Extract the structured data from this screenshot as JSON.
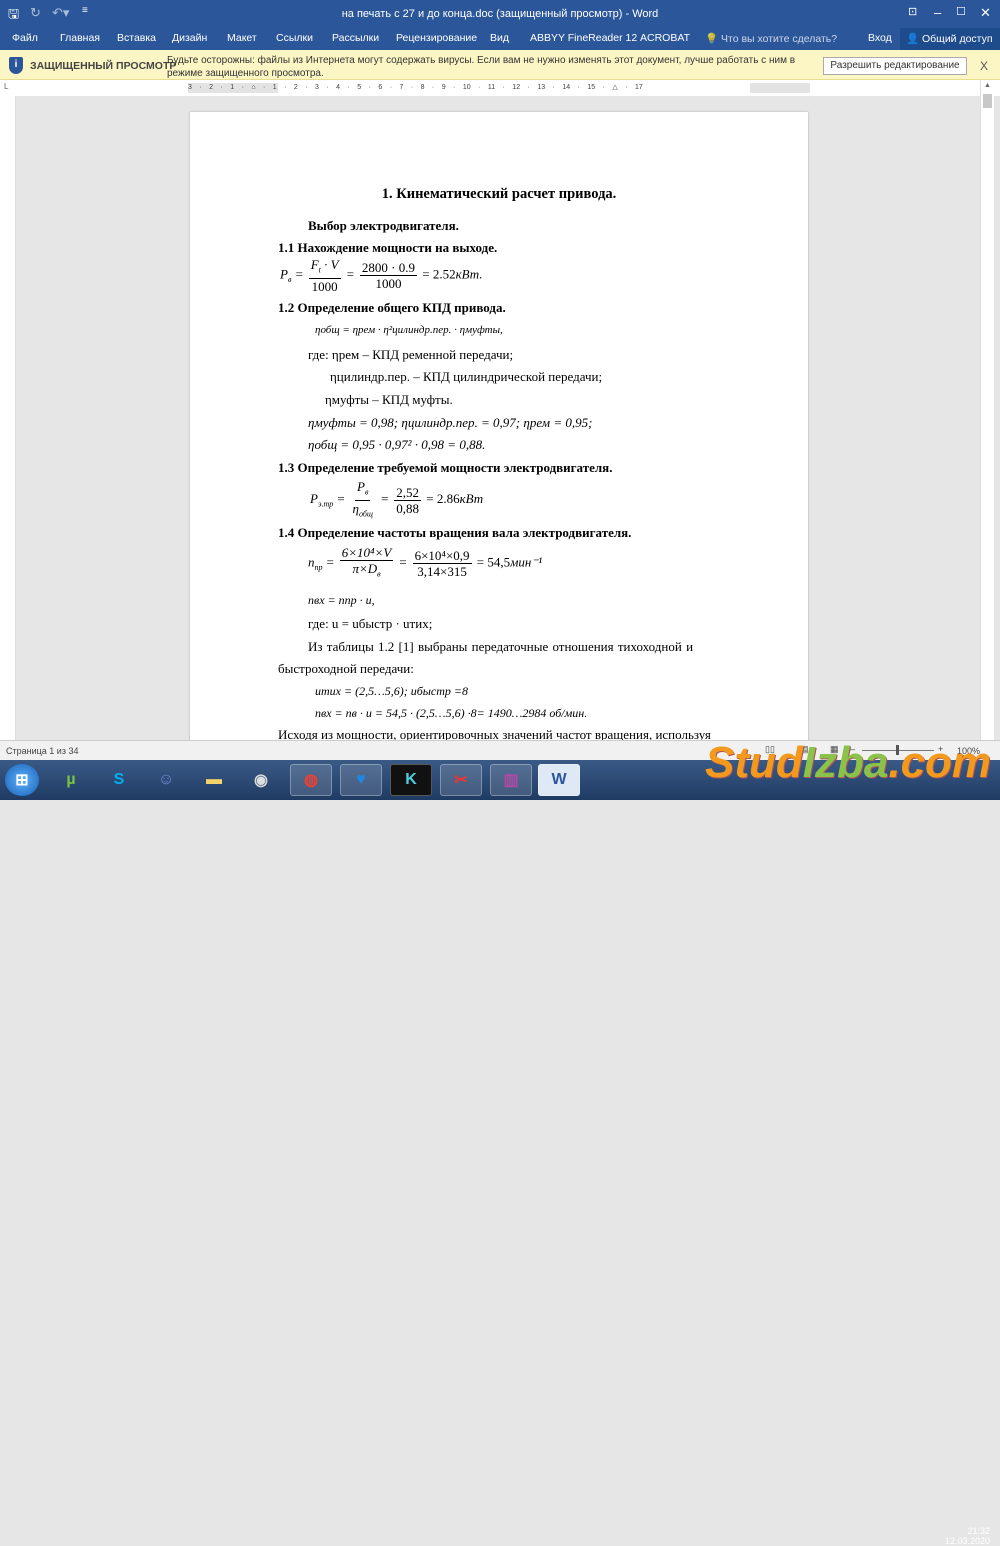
{
  "window": {
    "title": "на печать с 27 и до конца.doc (защищенный просмотр) - Word"
  },
  "ribbon": {
    "tabs": [
      "Файл",
      "Главная",
      "Вставка",
      "Дизайн",
      "Макет",
      "Ссылки",
      "Рассылки",
      "Рецензирование",
      "Вид",
      "ABBYY FineReader 12",
      "ACROBAT"
    ],
    "tell_me": "Что вы хотите сделать?",
    "signin": "Вход",
    "share": "Общий доступ"
  },
  "protected": {
    "label": "ЗАЩИЩЕННЫЙ ПРОСМОТР",
    "message": "Будьте осторожны: файлы из Интернета могут содержать вирусы. Если вам не нужно изменять этот документ, лучше работать с ним в режиме защищенного просмотра.",
    "enable_button": "Разрешить редактирование",
    "close": "X"
  },
  "ruler": {
    "labels": "3 · 2 · 1 · ⌂ · 1 · 2 · 3 · 4 · 5 · 6 · 7 · 8 · 9 · 10 · 11 · 12 · 13 · 14 · 15 · △ · 17"
  },
  "doc": {
    "title": "1. Кинематический расчет привода.",
    "sub": "Выбор электродвигателя.",
    "h11": "1.1  Нахождение мощности на выходе.",
    "f11": {
      "lhs": "P",
      "lhs_sub": "в",
      "num1": "F",
      "num1_sub": "t",
      "num1b": "· V",
      "den1": "1000",
      "num2": "2800 · 0.9",
      "den2": "1000",
      "res": "= 2.52",
      "unit": "кВт."
    },
    "h12": "1.2  Определение общего КПД привода.",
    "f12": "ηобщ = ηрем · η²цилиндр.пер. · ηмуфты,",
    "where1": "где:  ηрем – КПД ременной передачи;",
    "where2": "ηцилиндр.пер. – КПД цилиндрической передачи;",
    "where3": "ηмуфты – КПД муфты.",
    "vals": "ηмуфты = 0,98;  ηцилиндр.пер. = 0,97;  ηрем = 0,95;",
    "calc": "ηобщ = 0,95 · 0,97² · 0,98  = 0,88.",
    "h13": "1.3 Определение требуемой мощности электродвигателя.",
    "f13": {
      "lhs": "P",
      "lhs_sub": "э.тр",
      "num1": "P",
      "num1_sub": "в",
      "den1": "η",
      "den1_sub": "общ",
      "num2": "2,52",
      "den2": "0,88",
      "res": "= 2.86",
      "unit": "кВт"
    },
    "h14": "1.4 Определение частоты вращения вала электродвигателя.",
    "f14": {
      "lhs": "n",
      "lhs_sub": "пр",
      "num1": "6×10⁴×V",
      "den1": "π×D",
      "den1_sub": "в",
      "num2": "6×10⁴×0,9",
      "den2": "3,14×315",
      "res": "= 54,5",
      "unit": "мин⁻¹"
    },
    "nex": "nвх = nпр · u,",
    "where4": "где: u = uбыстр · uтих;",
    "para1a": "Из    таблицы    1.2    [1]    выбраны    передаточные    отношения    тихоходной    и",
    "para1b": "быстроходной передачи:",
    "u": "uтих = (2,5…5,6); uбыстр =8",
    "nex2": "nвх = nв · u = 54,5 · (2,5…5,6) ·8= 1490…2984 об/мин.",
    "para2": "Исходя из мощности, ориентировочных значений частот вращения, используя"
  },
  "status": {
    "page": "Страница 1 из 34",
    "zoom": "100%"
  },
  "taskbar": {
    "time": "21:32",
    "date": "12.03.2020",
    "apps": [
      "utorrent",
      "skype",
      "discord",
      "explorer",
      "steam",
      "chrome",
      "heart-app",
      "k-app",
      "scissors-app",
      "winrar",
      "word"
    ]
  },
  "watermark": "StudIzba.com"
}
